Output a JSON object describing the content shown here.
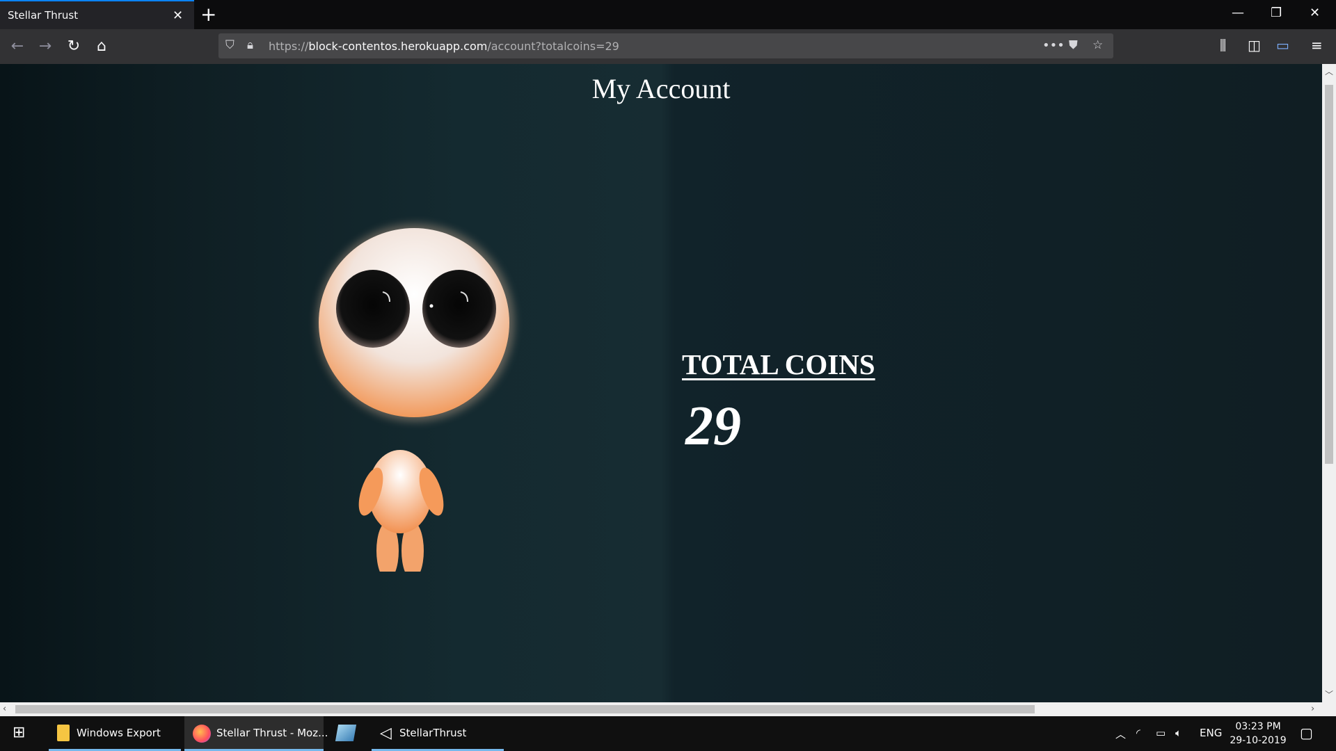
{
  "browser": {
    "tab_title": "Stellar Thrust",
    "url_prefix": "https://",
    "url_host": "block-contentos.herokuapp.com",
    "url_path": "/account?totalcoins=29"
  },
  "page": {
    "title": "My Account",
    "coins_label": "TOTAL COINS",
    "coins_value": "29"
  },
  "taskbar": {
    "items": [
      {
        "label": "Windows Export"
      },
      {
        "label": "Stellar Thrust - Moz..."
      },
      {
        "label": ""
      },
      {
        "label": "StellarThrust"
      }
    ],
    "language": "ENG",
    "time": "03:23 PM",
    "date": "29-10-2019"
  },
  "colors": {
    "accent": "#0a84ff",
    "page_background": "#142a30"
  }
}
